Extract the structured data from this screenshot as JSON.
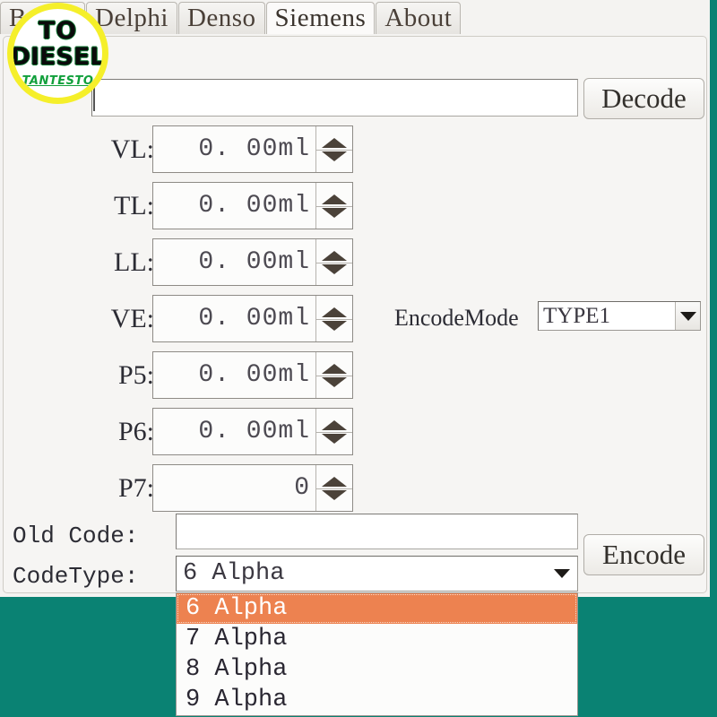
{
  "window": {
    "background_color": "#0A8273",
    "panel_color": "#F6F5F3"
  },
  "tabs": [
    {
      "label": "Bosch",
      "active": false
    },
    {
      "label": "Delphi",
      "active": false
    },
    {
      "label": "Denso",
      "active": false
    },
    {
      "label": "Siemens",
      "active": true
    },
    {
      "label": "About",
      "active": false
    }
  ],
  "top_row": {
    "code_input_value": "",
    "code_input_placeholder": "",
    "decode_label": "Decode"
  },
  "spinners": [
    {
      "label": "VL:",
      "value": "0. 00ml"
    },
    {
      "label": "TL:",
      "value": "0. 00ml"
    },
    {
      "label": "LL:",
      "value": "0. 00ml"
    },
    {
      "label": "VE:",
      "value": "0. 00ml"
    },
    {
      "label": "P5:",
      "value": "0. 00ml"
    },
    {
      "label": "P6:",
      "value": "0. 00ml"
    },
    {
      "label": "P7:",
      "value": "0"
    }
  ],
  "encode_mode": {
    "label": "EncodeMode",
    "selected": "TYPE1"
  },
  "bottom": {
    "old_code_label": "Old Code:",
    "old_code_value": "",
    "code_type_label": "CodeType:",
    "code_type_selected": "6 Alpha",
    "encode_label": "Encode"
  },
  "code_type_dropdown": {
    "open": true,
    "highlight_color": "#ED8250",
    "options": [
      {
        "label": "6 Alpha",
        "selected": true
      },
      {
        "label": "7 Alpha",
        "selected": false
      },
      {
        "label": "8 Alpha",
        "selected": false
      },
      {
        "label": "9 Alpha",
        "selected": false
      }
    ]
  },
  "watermark": {
    "line1": "TO",
    "line2": "DIESEL",
    "line3": "TANTESTO",
    "ring_color": "#F5EF2A",
    "text_color": "#0B0B0B",
    "accent_color": "#12A03C"
  }
}
